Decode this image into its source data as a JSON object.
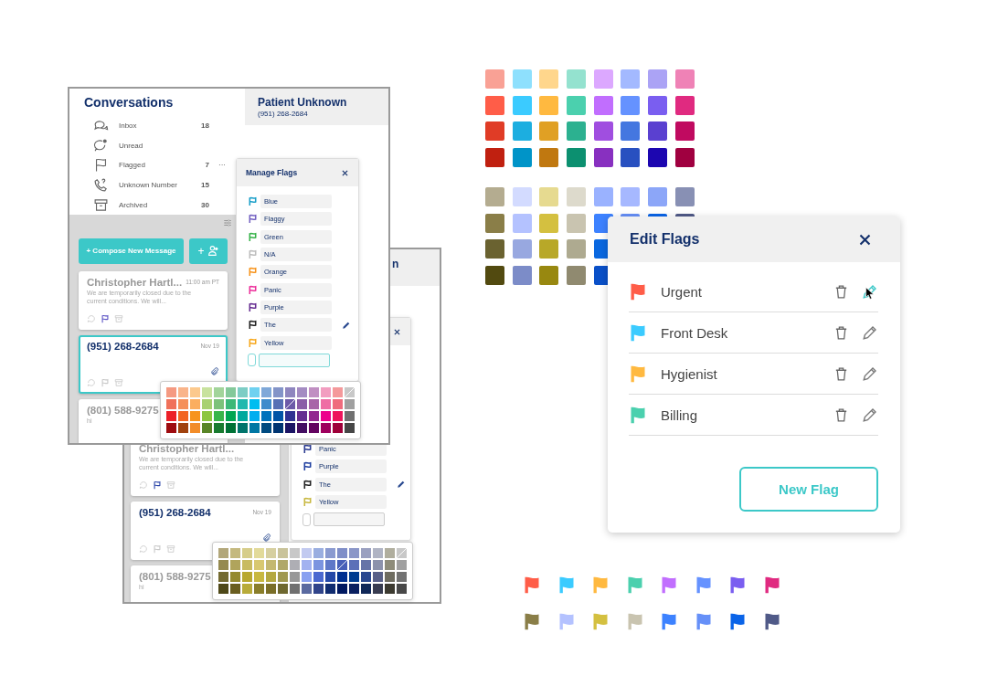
{
  "front_window": {
    "sidebar": {
      "title": "Conversations",
      "items": [
        {
          "kind": "inbox",
          "label": "Inbox",
          "count": "18"
        },
        {
          "kind": "unread",
          "label": "Unread"
        },
        {
          "kind": "flagged",
          "label": "Flagged",
          "count": "7",
          "menu": "···"
        },
        {
          "kind": "unknown",
          "label": "Unknown Number",
          "count": "15"
        },
        {
          "kind": "archived",
          "label": "Archived",
          "count": "30"
        }
      ]
    },
    "compose_button": "+ Compose New Message",
    "add_contact_button": "+",
    "cards": [
      {
        "name": "Christopher Hartl...",
        "time": "11:00 am PT",
        "preview": "We are temporarily closed due to the current conditions. We will...",
        "unread": false,
        "selected": false,
        "color": "#5b52c4"
      },
      {
        "name": "(951) 268-2684",
        "time": "Nov 19",
        "unread": true,
        "selected": true,
        "attachment": true
      },
      {
        "name": "(801) 588-9275",
        "preview": "hi",
        "unread": false,
        "selected": false
      }
    ],
    "header": {
      "name": "Patient Unknown",
      "phone": "(951) 268-2684"
    },
    "manage_flags": {
      "title": "Manage Flags",
      "input_focused": true,
      "flags": [
        {
          "label": "Blue",
          "color": "#1a9fc9"
        },
        {
          "label": "Flaggy",
          "color": "#7462c2"
        },
        {
          "label": "Green",
          "color": "#37b34a"
        },
        {
          "label": "N/A",
          "color": "#bdbdbd"
        },
        {
          "label": "Orange",
          "color": "#f7941d"
        },
        {
          "label": "Panic",
          "color": "#ec2f9a"
        },
        {
          "label": "Purple",
          "color": "#662d91"
        },
        {
          "label": "The",
          "color": "#222222",
          "editing": true
        },
        {
          "label": "Yellow",
          "color": "#f7a81d"
        }
      ]
    },
    "palette": [
      [
        {
          "color": "#f59a82",
          "slashed": false
        },
        {
          "color": "#f9b48a",
          "slashed": false
        },
        {
          "color": "#fcc98d",
          "slashed": false
        },
        {
          "color": "#c8e29e",
          "slashed": false
        },
        {
          "color": "#a2d49a",
          "slashed": false
        },
        {
          "color": "#84c99a",
          "slashed": false
        },
        {
          "color": "#7dcdc5",
          "slashed": false
        },
        {
          "color": "#6fd1f0",
          "slashed": false
        },
        {
          "color": "#7fa8d8",
          "slashed": false
        },
        {
          "color": "#8394c8",
          "slashed": false
        },
        {
          "color": "#8f86bf",
          "slashed": false
        },
        {
          "color": "#a48bc2",
          "slashed": false
        },
        {
          "color": "#c08fc2",
          "slashed": false
        },
        {
          "color": "#f29dc0",
          "slashed": false
        },
        {
          "color": "#f4999b",
          "slashed": false
        },
        {
          "color": "#c8c8c8",
          "slashed": true
        }
      ],
      [
        {
          "color": "#f0715a",
          "slashed": false
        },
        {
          "color": "#f58f5a",
          "slashed": false
        },
        {
          "color": "#fbae5f",
          "slashed": false
        },
        {
          "color": "#a8d170",
          "slashed": false
        },
        {
          "color": "#7cc27a",
          "slashed": false
        },
        {
          "color": "#3cb878",
          "slashed": false
        },
        {
          "color": "#21b8ae",
          "slashed": false
        },
        {
          "color": "#00bdf0",
          "slashed": false
        },
        {
          "color": "#3f8ccc",
          "slashed": false
        },
        {
          "color": "#5670b5",
          "slashed": false
        },
        {
          "color": "#6c5aa8",
          "slashed": true
        },
        {
          "color": "#8b5ea8",
          "slashed": false
        },
        {
          "color": "#a864a8",
          "slashed": false
        },
        {
          "color": "#ef6ca4",
          "slashed": false
        },
        {
          "color": "#ef6b7d",
          "slashed": false
        },
        {
          "color": "#a0a0a0",
          "slashed": false
        }
      ],
      [
        {
          "color": "#ec2028",
          "slashed": false
        },
        {
          "color": "#f26522",
          "slashed": false
        },
        {
          "color": "#f7941d",
          "slashed": false
        },
        {
          "color": "#8dc63f",
          "slashed": false
        },
        {
          "color": "#39b54a",
          "slashed": false
        },
        {
          "color": "#00a651",
          "slashed": false
        },
        {
          "color": "#00a99d",
          "slashed": false
        },
        {
          "color": "#00aeef",
          "slashed": false
        },
        {
          "color": "#0072bc",
          "slashed": false
        },
        {
          "color": "#0054a6",
          "slashed": false
        },
        {
          "color": "#2e3192",
          "slashed": false
        },
        {
          "color": "#662d91",
          "slashed": false
        },
        {
          "color": "#92278f",
          "slashed": false
        },
        {
          "color": "#ec008c",
          "slashed": false
        },
        {
          "color": "#ed145b",
          "slashed": false
        },
        {
          "color": "#707070",
          "slashed": false
        }
      ],
      [
        {
          "color": "#9e0b0f",
          "slashed": false
        },
        {
          "color": "#a0410d",
          "slashed": false
        },
        {
          "color": "#f28c28",
          "slashed": false
        },
        {
          "color": "#598527",
          "slashed": false
        },
        {
          "color": "#197b30",
          "slashed": false
        },
        {
          "color": "#007236",
          "slashed": false
        },
        {
          "color": "#00746b",
          "slashed": false
        },
        {
          "color": "#0076a3",
          "slashed": false
        },
        {
          "color": "#004a80",
          "slashed": false
        },
        {
          "color": "#003471",
          "slashed": false
        },
        {
          "color": "#1b1464",
          "slashed": false
        },
        {
          "color": "#440e62",
          "slashed": false
        },
        {
          "color": "#630460",
          "slashed": false
        },
        {
          "color": "#9e005d",
          "slashed": false
        },
        {
          "color": "#9e0039",
          "slashed": false
        },
        {
          "color": "#464646",
          "slashed": false
        }
      ]
    ]
  },
  "back_window": {
    "cards": [
      {
        "name": "Christopher Hartl...",
        "preview": "We are temporarily closed due to the current conditions. We will...",
        "unread": false,
        "selected": false,
        "color": "#2a44a8"
      },
      {
        "name": "(951) 268-2684",
        "time": "Nov 19",
        "unread": true,
        "selected": false,
        "attachment": true
      },
      {
        "name": "(801) 588-9275",
        "preview": "hi",
        "unread": false,
        "selected": false
      }
    ],
    "header": {
      "name": "n"
    },
    "manage_flags": {
      "input_focused": false,
      "flags": [
        {
          "label": "Panic",
          "color": "#2a3a90"
        },
        {
          "label": "Purple",
          "color": "#2040a0"
        },
        {
          "label": "The",
          "color": "#222222",
          "editing": true
        },
        {
          "label": "Yellow",
          "color": "#c8b840"
        }
      ]
    },
    "palette": [
      [
        {
          "color": "#b2a77a",
          "slashed": false
        },
        {
          "color": "#c4b97f",
          "slashed": false
        },
        {
          "color": "#d6cd8a",
          "slashed": false
        },
        {
          "color": "#e2da9a",
          "slashed": false
        },
        {
          "color": "#d6cfa0",
          "slashed": false
        },
        {
          "color": "#c9c39a",
          "slashed": false
        },
        {
          "color": "#c8c8c8",
          "slashed": false
        },
        {
          "color": "#c2caf0",
          "slashed": false
        },
        {
          "color": "#9aaee0",
          "slashed": false
        },
        {
          "color": "#8a9ad0",
          "slashed": false
        },
        {
          "color": "#7f8ec8",
          "slashed": false
        },
        {
          "color": "#8a96c8",
          "slashed": false
        },
        {
          "color": "#9aa0c0",
          "slashed": false
        },
        {
          "color": "#b0b4c4",
          "slashed": false
        },
        {
          "color": "#b0ae9e",
          "slashed": false
        },
        {
          "color": "#c8c8c8",
          "slashed": true
        }
      ],
      [
        {
          "color": "#958a50",
          "slashed": false
        },
        {
          "color": "#b0a45c",
          "slashed": false
        },
        {
          "color": "#c8bb60",
          "slashed": false
        },
        {
          "color": "#d8c870",
          "slashed": false
        },
        {
          "color": "#c4b870",
          "slashed": false
        },
        {
          "color": "#b0a868",
          "slashed": false
        },
        {
          "color": "#aeaeb4",
          "slashed": false
        },
        {
          "color": "#a2b2f0",
          "slashed": false
        },
        {
          "color": "#7b94e0",
          "slashed": false
        },
        {
          "color": "#5f78c8",
          "slashed": false
        },
        {
          "color": "#4860b8",
          "slashed": true
        },
        {
          "color": "#5c70b8",
          "slashed": false
        },
        {
          "color": "#6674a8",
          "slashed": false
        },
        {
          "color": "#8c92ac",
          "slashed": false
        },
        {
          "color": "#8e8c7a",
          "slashed": false
        },
        {
          "color": "#a0a0a0",
          "slashed": false
        }
      ],
      [
        {
          "color": "#736a30",
          "slashed": false
        },
        {
          "color": "#958a30",
          "slashed": false
        },
        {
          "color": "#b8a830",
          "slashed": false
        },
        {
          "color": "#c8b840",
          "slashed": false
        },
        {
          "color": "#b4a840",
          "slashed": false
        },
        {
          "color": "#a09850",
          "slashed": false
        },
        {
          "color": "#989898",
          "slashed": false
        },
        {
          "color": "#88a0f0",
          "slashed": false
        },
        {
          "color": "#4a68d0",
          "slashed": false
        },
        {
          "color": "#2448a8",
          "slashed": false
        },
        {
          "color": "#003090",
          "slashed": false
        },
        {
          "color": "#003c90",
          "slashed": false
        },
        {
          "color": "#2a4890",
          "slashed": false
        },
        {
          "color": "#586088",
          "slashed": false
        },
        {
          "color": "#6e6c60",
          "slashed": false
        },
        {
          "color": "#727272",
          "slashed": false
        }
      ],
      [
        {
          "color": "#4e4818",
          "slashed": false
        },
        {
          "color": "#6a5e20",
          "slashed": false
        },
        {
          "color": "#b8ab3a",
          "slashed": false
        },
        {
          "color": "#8a7e2a",
          "slashed": false
        },
        {
          "color": "#7a6e28",
          "slashed": false
        },
        {
          "color": "#6e6830",
          "slashed": false
        },
        {
          "color": "#707070",
          "slashed": false
        },
        {
          "color": "#5a6aa0",
          "slashed": false
        },
        {
          "color": "#30448a",
          "slashed": false
        },
        {
          "color": "#102c70",
          "slashed": false
        },
        {
          "color": "#001860",
          "slashed": false
        },
        {
          "color": "#0a2060",
          "slashed": false
        },
        {
          "color": "#102858",
          "slashed": false
        },
        {
          "color": "#383c50",
          "slashed": false
        },
        {
          "color": "#3c3a30",
          "slashed": false
        },
        {
          "color": "#484848",
          "slashed": false
        }
      ]
    ]
  },
  "swatch_grids": [
    {
      "rows": [
        [
          {
            "color": "#f9a195"
          },
          {
            "color": "#8ee0fd"
          },
          {
            "color": "#ffd68c"
          },
          {
            "color": "#94e2cf"
          },
          {
            "color": "#dca8ff"
          },
          {
            "color": "#a3b9ff"
          },
          {
            "color": "#aba3f5"
          },
          {
            "color": "#ef82b6"
          }
        ],
        [
          {
            "color": "#ff5d48"
          },
          {
            "color": "#3bcbff"
          },
          {
            "color": "#ffb940"
          },
          {
            "color": "#4bd0ae"
          },
          {
            "color": "#c16efe"
          },
          {
            "color": "#6592ff"
          },
          {
            "color": "#7a5ef0"
          },
          {
            "color": "#e02a80"
          }
        ],
        [
          {
            "color": "#e03c26"
          },
          {
            "color": "#1caee0"
          },
          {
            "color": "#e0a024"
          },
          {
            "color": "#2cb190"
          },
          {
            "color": "#a04ee0"
          },
          {
            "color": "#4477e0"
          },
          {
            "color": "#5a40d0"
          },
          {
            "color": "#c00a60"
          }
        ],
        [
          {
            "color": "#c02010"
          },
          {
            "color": "#0094c8"
          },
          {
            "color": "#c07810"
          },
          {
            "color": "#0c9070"
          },
          {
            "color": "#8830c0"
          },
          {
            "color": "#2850c0"
          },
          {
            "color": "#1c06b0"
          },
          {
            "color": "#a00040"
          }
        ]
      ]
    },
    {
      "rows": [
        [
          {
            "color": "#b4ac90"
          },
          {
            "color": "#d3dbff"
          },
          {
            "color": "#e6da90"
          },
          {
            "color": "#dddacc"
          },
          {
            "color": "#9ab2ff"
          },
          {
            "color": "#a6b8ff"
          },
          {
            "color": "#8ca6f8"
          },
          {
            "color": "#8890b4"
          }
        ],
        [
          {
            "color": "#8a7e48"
          },
          {
            "color": "#b4c2ff"
          },
          {
            "color": "#d4c040"
          },
          {
            "color": "#c9c4b0"
          },
          {
            "color": "#3d82ff"
          },
          {
            "color": "#6690f8"
          },
          {
            "color": "#0a64e8"
          },
          {
            "color": "#505a88"
          }
        ],
        [
          {
            "color": "#6a6230"
          },
          {
            "color": "#98a8e0"
          },
          {
            "color": "#b8a828"
          },
          {
            "color": "#aeaa90"
          },
          {
            "color": "#0a68e0"
          }
        ],
        [
          {
            "color": "#524a10"
          },
          {
            "color": "#7c8cc8"
          },
          {
            "color": "#988810"
          },
          {
            "color": "#908a70"
          },
          {
            "color": "#0a50c8"
          }
        ]
      ]
    }
  ],
  "edit_flags": {
    "title": "Edit Flags",
    "flags": [
      {
        "label": "Urgent",
        "color": "#ff5d48",
        "hovered": true
      },
      {
        "label": "Front Desk",
        "color": "#3bcbff",
        "hovered": false
      },
      {
        "label": "Hygienist",
        "color": "#ffb940",
        "hovered": false
      },
      {
        "label": "Billing",
        "color": "#4bd0ae",
        "hovered": false
      }
    ],
    "button": "New Flag"
  },
  "flag_icons": [
    [
      {
        "color": "#ff5d48"
      },
      {
        "color": "#3bcbff"
      },
      {
        "color": "#ffb940"
      },
      {
        "color": "#4bd0ae"
      },
      {
        "color": "#c16efe"
      },
      {
        "color": "#6592ff"
      },
      {
        "color": "#7a5ef0"
      },
      {
        "color": "#e02a80"
      }
    ],
    [
      {
        "color": "#8a7e48"
      },
      {
        "color": "#b4c2ff"
      },
      {
        "color": "#d4c040"
      },
      {
        "color": "#c9c4b0"
      },
      {
        "color": "#3d82ff"
      },
      {
        "color": "#6690f8"
      },
      {
        "color": "#0a64e8"
      },
      {
        "color": "#505a88"
      }
    ]
  ]
}
